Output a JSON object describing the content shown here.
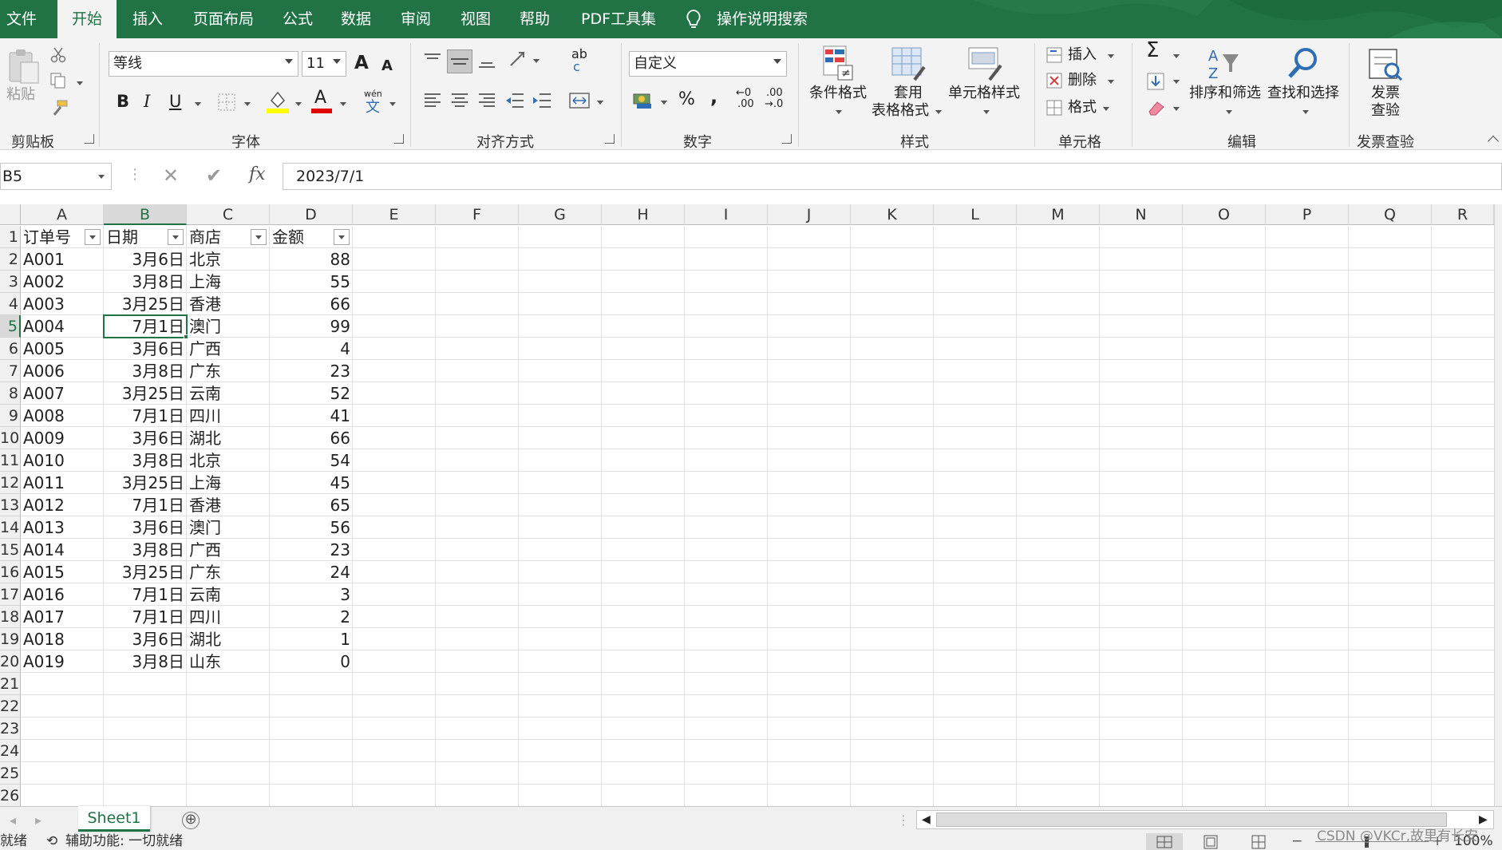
{
  "tabs": [
    "文件",
    "开始",
    "插入",
    "页面布局",
    "公式",
    "数据",
    "审阅",
    "视图",
    "帮助",
    "PDF工具集"
  ],
  "active_tab": "开始",
  "tell_me": "操作说明搜索",
  "ribbon": {
    "clipboard": {
      "paste": "粘贴",
      "group": "剪贴板"
    },
    "font": {
      "name": "等线",
      "size": "11",
      "group": "字体",
      "grow": "A",
      "shrink": "A",
      "bold": "B",
      "italic": "I",
      "underline": "U",
      "phonetic_top": "wén",
      "phonetic_bottom": "文",
      "font_color_letter": "A"
    },
    "alignment": {
      "group": "对齐方式",
      "wrap_top": "ab",
      "wrap_bottom": "c"
    },
    "number": {
      "format": "自定义",
      "group": "数字",
      "percent": "%",
      "comma": ",",
      "inc_decimal_top": "←0",
      "inc_decimal_bottom": ".00",
      "dec_decimal_top": ".00",
      "dec_decimal_bottom": "→.0"
    },
    "styles": {
      "conditional": "条件格式",
      "table_line1": "套用",
      "table_line2": "表格格式",
      "cell_styles": "单元格样式",
      "group": "样式"
    },
    "cells": {
      "insert": "插入",
      "delete": "删除",
      "format": "格式",
      "group": "单元格"
    },
    "editing": {
      "sum": "Σ",
      "sort_filter": "排序和筛选",
      "find_select": "查找和选择",
      "group": "编辑"
    },
    "invoice": {
      "line1": "发票",
      "line2": "查验",
      "group": "发票查验"
    }
  },
  "formula_bar": {
    "name_box": "B5",
    "value": "2023/7/1",
    "cancel": "✕",
    "enter": "✔",
    "fx": "fx"
  },
  "columns": [
    "A",
    "B",
    "C",
    "D",
    "E",
    "F",
    "G",
    "H",
    "I",
    "J",
    "K",
    "L",
    "M",
    "N",
    "O",
    "P",
    "Q",
    "R"
  ],
  "row_numbers": [
    "1",
    "2",
    "3",
    "4",
    "5",
    "6",
    "7",
    "8",
    "9",
    "10",
    "11",
    "12",
    "13",
    "14",
    "15",
    "16",
    "17",
    "18",
    "19",
    "20",
    "21",
    "22",
    "23",
    "24",
    "25",
    "26"
  ],
  "table": {
    "headers": [
      "订单号",
      "日期",
      "商店",
      "金额"
    ],
    "rows": [
      [
        "A001",
        "3月6日",
        "北京",
        "88"
      ],
      [
        "A002",
        "3月8日",
        "上海",
        "55"
      ],
      [
        "A003",
        "3月25日",
        "香港",
        "66"
      ],
      [
        "A004",
        "7月1日",
        "澳门",
        "99"
      ],
      [
        "A005",
        "3月6日",
        "广西",
        "4"
      ],
      [
        "A006",
        "3月8日",
        "广东",
        "23"
      ],
      [
        "A007",
        "3月25日",
        "云南",
        "52"
      ],
      [
        "A008",
        "7月1日",
        "四川",
        "41"
      ],
      [
        "A009",
        "3月6日",
        "湖北",
        "66"
      ],
      [
        "A010",
        "3月8日",
        "北京",
        "54"
      ],
      [
        "A011",
        "3月25日",
        "上海",
        "45"
      ],
      [
        "A012",
        "7月1日",
        "香港",
        "65"
      ],
      [
        "A013",
        "3月6日",
        "澳门",
        "56"
      ],
      [
        "A014",
        "3月8日",
        "广西",
        "23"
      ],
      [
        "A015",
        "3月25日",
        "广东",
        "24"
      ],
      [
        "A016",
        "7月1日",
        "云南",
        "3"
      ],
      [
        "A017",
        "7月1日",
        "四川",
        "2"
      ],
      [
        "A018",
        "3月6日",
        "湖北",
        "1"
      ],
      [
        "A019",
        "3月8日",
        "山东",
        "0"
      ]
    ]
  },
  "selected_cell": "B5",
  "sheet_tab": "Sheet1",
  "add_sheet": "⊕",
  "status": {
    "ready": "就绪",
    "accessibility": "辅助功能: 一切就绪",
    "zoom": "100%",
    "watermark": "CSDN @VKCr,故里有长安"
  },
  "colors": {
    "accent": "#217346",
    "ribbon_bg": "#f3f3f3",
    "grid_line": "#e1e1e1"
  }
}
